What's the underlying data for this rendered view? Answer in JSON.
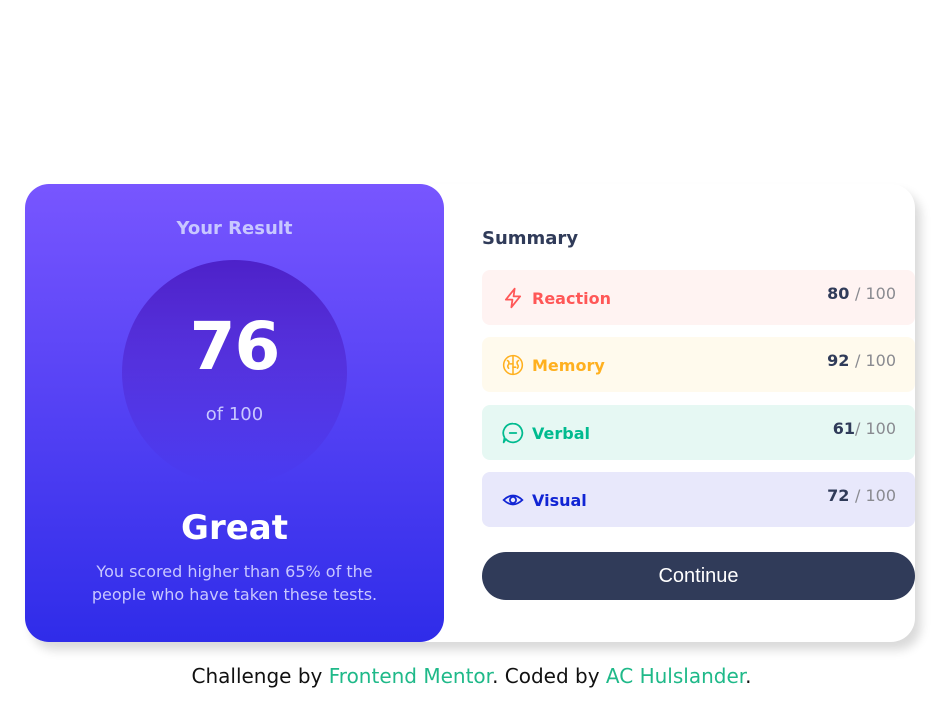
{
  "result": {
    "heading": "Your Result",
    "score": "76",
    "of_text": "of 100",
    "rating": "Great",
    "description": "You scored higher than 65% of the people who have taken these tests."
  },
  "summary": {
    "title": "Summary",
    "items": [
      {
        "label": "Reaction",
        "score": "80",
        "total": "/ 100",
        "icon": "lightning-icon",
        "color": "#ff5757",
        "bg": "#fff3f2"
      },
      {
        "label": "Memory",
        "score": "92",
        "total": "/ 100",
        "icon": "brain-icon",
        "color": "#ffb01f",
        "bg": "#fffaed"
      },
      {
        "label": "Verbal",
        "score": "61",
        "total": "/ 100",
        "icon": "chat-bubble-icon",
        "color": "#00bb8f",
        "bg": "#e6f8f3"
      },
      {
        "label": "Visual",
        "score": "72",
        "total": "/ 100",
        "icon": "eye-icon",
        "color": "#1125d4",
        "bg": "#e8e8fb"
      }
    ],
    "continue_label": "Continue"
  },
  "attribution": {
    "prefix": "Challenge by ",
    "link1": "Frontend Mentor",
    "middle": ". Coded by ",
    "link2": "AC Hulslander",
    "suffix": "."
  }
}
